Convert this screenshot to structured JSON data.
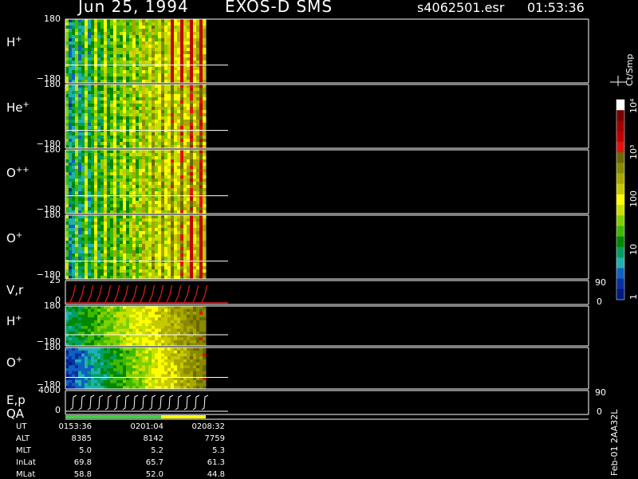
{
  "header": {
    "date": "Jun 25, 1994",
    "instrument": "EXOS-D SMS",
    "file": "s4062501.esr",
    "time": "01:53:36"
  },
  "panels": [
    {
      "label": "H",
      "sup": "+",
      "top_tick": "180",
      "bot_tick": "−180"
    },
    {
      "label": "He",
      "sup": "+",
      "top_tick": "180",
      "bot_tick": "−180"
    },
    {
      "label": "O",
      "sup": "++",
      "top_tick": "180",
      "bot_tick": "−180"
    },
    {
      "label": "O",
      "sup": "+",
      "top_tick": "180",
      "bot_tick": "−180"
    },
    {
      "label": "V,r",
      "sup": "",
      "top_tick": "25",
      "bot_tick": "0",
      "right_top": "90",
      "right_bot": "0"
    },
    {
      "label": "H",
      "sup": "+",
      "top_tick": "180",
      "bot_tick": "−180"
    },
    {
      "label": "O",
      "sup": "+",
      "top_tick": "180",
      "bot_tick": "−180"
    },
    {
      "label": "E,p",
      "sup": "",
      "top_tick": "4000",
      "bot_tick": "0",
      "right_top": "90",
      "right_bot": "0"
    }
  ],
  "qa_label": "QA",
  "colorbar": {
    "unit": "Ct/Smp",
    "ticks": [
      "10⁴",
      "10³",
      "100",
      "10",
      "1"
    ],
    "colors": [
      "#ffffff",
      "#7a0000",
      "#a00000",
      "#c00000",
      "#e01010",
      "#6a6a00",
      "#8a8a00",
      "#a8a800",
      "#c8c800",
      "#ffff00",
      "#c8e000",
      "#80d000",
      "#40b800",
      "#008800",
      "#00a060",
      "#20b0b0",
      "#1060c0",
      "#0830a0",
      "#001880"
    ]
  },
  "footer": {
    "rows": [
      {
        "name": "UT",
        "v": [
          "0153:36",
          "0201:04",
          "0208:32"
        ]
      },
      {
        "name": "ALT",
        "v": [
          "8385",
          "8142",
          "7759"
        ]
      },
      {
        "name": "MLT",
        "v": [
          "5.0",
          "5.2",
          "5.3"
        ]
      },
      {
        "name": "InLat",
        "v": [
          "69.8",
          "65.7",
          "61.3"
        ]
      },
      {
        "name": "MLat",
        "v": [
          "58.8",
          "52.0",
          "44.8"
        ]
      }
    ],
    "version": "Feb-01 2AA32L"
  },
  "chart_data": {
    "type": "heatmap",
    "title": "Jun 25, 1994   EXOS-D SMS",
    "panels": [
      "H+",
      "He+",
      "O++",
      "O+",
      "V,r",
      "H+",
      "O+",
      "E,p"
    ],
    "x": [
      "0153:36",
      "0201:04",
      "0208:32"
    ],
    "colorbar_unit": "Ct/Smp",
    "colorbar_range": [
      1,
      10000
    ],
    "colorbar_scale": "log"
  }
}
